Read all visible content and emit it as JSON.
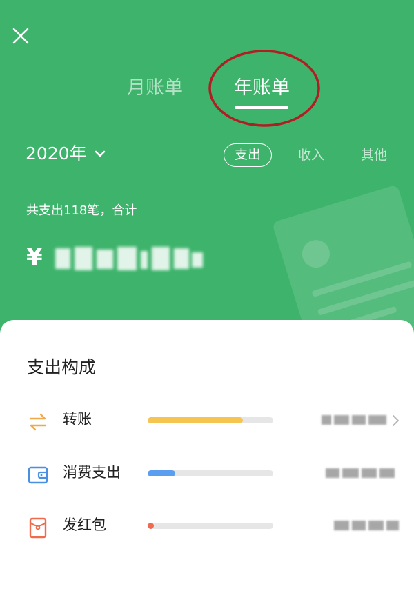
{
  "header": {
    "tabs": [
      {
        "label": "月账单",
        "active": false
      },
      {
        "label": "年账单",
        "active": true
      }
    ],
    "year": "2020年",
    "filters": [
      {
        "label": "支出",
        "active": true
      },
      {
        "label": "收入",
        "active": false
      },
      {
        "label": "其他",
        "active": false
      }
    ],
    "summary_count": "共支出118笔，合计",
    "currency": "¥",
    "colors": {
      "background": "#3db36b",
      "highlight_circle": "#b01e23"
    }
  },
  "breakdown": {
    "title": "支出构成",
    "items": [
      {
        "label": "转账",
        "icon": "transfer-arrows-icon",
        "share": 0.76,
        "bar_color": "#f5c451"
      },
      {
        "label": "消费支出",
        "icon": "wallet-icon",
        "share": 0.22,
        "bar_color": "#5b9ef0"
      },
      {
        "label": "发红包",
        "icon": "red-packet-icon",
        "share": 0.05,
        "bar_color": "#f06a52"
      }
    ]
  }
}
